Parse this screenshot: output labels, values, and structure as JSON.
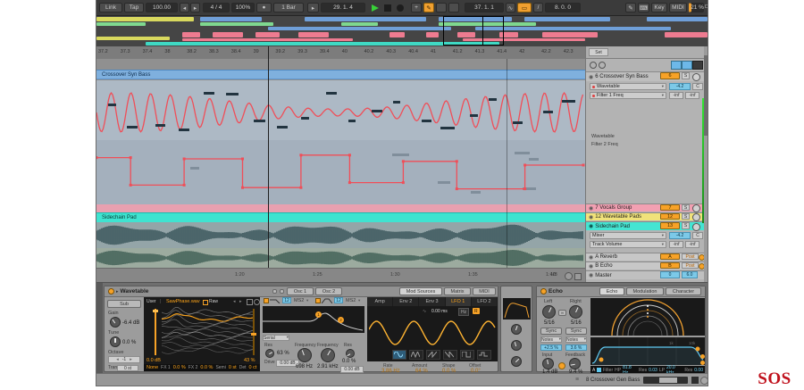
{
  "icons": {
    "caret": "▾",
    "metronome": "●",
    "follow": "▸",
    "pencil": "✎",
    "keyboard": "⌨",
    "plus": "+",
    "loop": "▭",
    "grip": "≡",
    "link": "∞",
    "circle_btn": "○",
    "square_btn": "▪",
    "radio": "◉",
    "wave": "∿"
  },
  "transport": {
    "link": "Link",
    "tap": "Tap",
    "tempo": "100.00",
    "nudge_down": "◂",
    "nudge_up": "▸",
    "time_sig": "4 / 4",
    "groove_amount": "100%",
    "quantize": "1 Bar",
    "position": "29. 1. 4",
    "loop_start": "37. 1. 1",
    "loop_length": "8. 0. 0",
    "key": "Key",
    "midi": "MIDI",
    "cpu": "21 %",
    "disk": "D"
  },
  "overview_rows": [
    {
      "y": 1,
      "h": 5,
      "c": "#d8d85e",
      "segs": [
        [
          0,
          16
        ]
      ]
    },
    {
      "y": 1,
      "h": 5,
      "c": "#6f9fd8",
      "segs": [
        [
          17,
          10
        ],
        [
          34,
          20
        ],
        [
          56,
          12
        ],
        [
          70,
          14
        ],
        [
          90,
          10
        ]
      ]
    },
    {
      "y": 7,
      "h": 4,
      "c": "#7fd88f",
      "segs": [
        [
          0,
          8
        ],
        [
          17,
          12
        ],
        [
          40,
          6
        ],
        [
          56,
          16
        ]
      ]
    },
    {
      "y": 12,
      "h": 4,
      "c": "#6f9fd8",
      "segs": [
        [
          28,
          30
        ],
        [
          62,
          32
        ]
      ]
    },
    {
      "y": 18,
      "h": 6,
      "c": "#ee7b90",
      "segs": [
        [
          14,
          3
        ],
        [
          19,
          5
        ],
        [
          26,
          4
        ],
        [
          33,
          5
        ],
        [
          48,
          2.5
        ],
        [
          54,
          2
        ],
        [
          59,
          3
        ],
        [
          66,
          3
        ],
        [
          73,
          9
        ],
        [
          93,
          7
        ]
      ]
    },
    {
      "y": 23,
      "h": 4,
      "c": "#d8d85e",
      "segs": [
        [
          0,
          12
        ]
      ]
    },
    {
      "y": 25,
      "h": 3,
      "c": "#ee7b90",
      "segs": [
        [
          14,
          28
        ],
        [
          60,
          20
        ]
      ]
    },
    {
      "y": 29,
      "h": 4,
      "c": "#3fd9c4",
      "segs": [
        [
          8,
          58
        ]
      ]
    }
  ],
  "ruler_ticks": [
    "37.2",
    "37.3",
    "37.4",
    "38",
    "38.2",
    "38.3",
    "38.4",
    "39",
    "39.2",
    "39.3",
    "39.4",
    "40",
    "40.2",
    "40.3",
    "40.4",
    "41",
    "41.2",
    "41.3",
    "41.4",
    "42",
    "42.2",
    "42.3"
  ],
  "arrangement": {
    "set_label": "Set",
    "clip1_title": "Crossover Syn Bass",
    "clip2_title": "Sidechain Pad",
    "lane_device": "Wavetable",
    "lane_param": "Filter 2 Freq",
    "automation_steps": [
      [
        0,
        28
      ],
      [
        7,
        28
      ],
      [
        7,
        72
      ],
      [
        18,
        72
      ],
      [
        18,
        30
      ],
      [
        30,
        30
      ],
      [
        30,
        76
      ],
      [
        42,
        76
      ],
      [
        42,
        24
      ],
      [
        52,
        24
      ],
      [
        52,
        68
      ],
      [
        63,
        68
      ],
      [
        63,
        34
      ],
      [
        74,
        34
      ],
      [
        74,
        78
      ],
      [
        88,
        78
      ],
      [
        88,
        40
      ],
      [
        100,
        40
      ]
    ]
  },
  "track_panel": {
    "track1": {
      "name": "6 Crossover Syn Bass",
      "num": "6",
      "solo": "S",
      "device": "Wavetable",
      "volume": "-4.2",
      "pan": "C",
      "param": "Filter 1 Freq",
      "min": "-inf",
      "max": "-inf"
    },
    "vocals": {
      "name": "7 Vocals Group",
      "num": "7",
      "solo": "S"
    },
    "pads": {
      "name": "12 Wavetable Pads",
      "num": "12",
      "solo": "S"
    },
    "sidechain": {
      "name": "Sidechain Pad",
      "num": "13",
      "solo": "S",
      "device": "Mixer",
      "volume": "-4.2",
      "pan": "C",
      "param": "Track Volume",
      "min": "-inf",
      "max": "-inf"
    },
    "return_a": {
      "name": "A Reverb",
      "num": "A",
      "mode": "Post"
    },
    "return_b": {
      "name": "B Echo",
      "num": "B",
      "mode": "Post"
    },
    "master": {
      "name": "Master",
      "volume": "0",
      "pan": "6.0"
    }
  },
  "lower_ruler": {
    "ticks": [
      "1:20",
      "1:25",
      "1:30",
      "1:35",
      "1:40"
    ],
    "grid": "1/8"
  },
  "wavetable": {
    "title": "Wavetable",
    "osc1_tab": "Osc 1",
    "osc2_tab": "Osc 2",
    "mod_tab": "Mod Sources",
    "matrix_tab": "Matrix",
    "midi_tab": "MIDI",
    "sub": "Sub",
    "gain_label": "Gain",
    "gain_value": "-6.4 dB",
    "tune_label": "Tune",
    "tune_value": "0.0 %",
    "octave_label": "Octave",
    "octave_value": "-1",
    "transpose_label": "Transpose",
    "transpose_value": "0 st",
    "category": "User",
    "table_name": "SawPhase.wav",
    "raw_label": "Raw",
    "osc_gain": "0.0 dB",
    "position": "43 %",
    "effect_mode": "None",
    "fx1_label": "FX 1",
    "fx1_value": "0.0 %",
    "fx2_label": "FX 2",
    "fx2_value": "0.0 %",
    "semi_label": "Semi",
    "semi_value": "0 st",
    "det_label": "Det",
    "det_value": "0 ct",
    "filter": {
      "f1_slope": "12",
      "f1_circuit": "MS2",
      "f2_slope": "12",
      "f2_circuit": "MS2",
      "routing": "Serial",
      "marker1": "1",
      "marker2": "2",
      "res1_label": "Res",
      "res1": "63 %",
      "drive1_label": "Drive",
      "drive1": "0.00 dB",
      "freq1_label": "Frequency",
      "freq1": "698 Hz",
      "freq2_label": "Frequency",
      "freq2": "2.91 kHz",
      "res2_label": "Res",
      "res2": "0.0 %",
      "drive2_label": "Drive",
      "drive2": "0.00 dB"
    },
    "mod": {
      "subtabs": [
        "Amp",
        "Env 2",
        "Env 3",
        "LFO 1",
        "LFO 2"
      ],
      "active_subtab": "LFO 1",
      "attack": "0.00 ms",
      "hz": "Hz",
      "retrig": "R",
      "rate_label": "Rate",
      "rate": "3.86 Hz",
      "amount_label": "Amount",
      "amount": "64 %",
      "shape_label": "Shape",
      "shape": "0.0 %",
      "offset_label": "Offset",
      "offset": "0.0°"
    }
  },
  "echo": {
    "title": "Echo",
    "tab_echo": "Echo",
    "tab_mod": "Modulation",
    "tab_char": "Character",
    "left_label": "Left",
    "left_value": "5/16",
    "right_label": "Right",
    "right_value": "5/16",
    "sync_label": "Sync",
    "notes_label": "Notes",
    "left_offset": "+2.5 %",
    "right_offset": "3.6 %",
    "input_label": "Input",
    "input_value": "1.4 dB",
    "feedback_label": "Feedback",
    "feedback_value": "9.4 %",
    "filter_a": "A",
    "filter_label": "Filter",
    "hp_label": "HP",
    "hp_freq": "81.8 Hz",
    "res1_label": "Res",
    "res1": "0.03",
    "lp_label": "LP",
    "lp_freq": "20.0 kHz",
    "res2_label": "Res",
    "res2": "0.00",
    "grid1": "1k",
    "grid2": "10k"
  },
  "status_bar": {
    "device_label": "8 Crossover Gen Bass"
  },
  "logo": "SOS"
}
